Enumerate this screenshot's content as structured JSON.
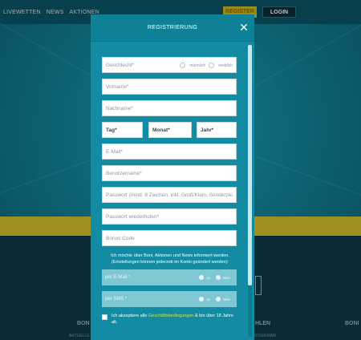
{
  "background": {
    "nav": [
      "LIVEWETTEN",
      "NEWS",
      "AKTIONEN"
    ],
    "register_label": "REGISTER",
    "login_label": "LOGIN",
    "footer_left": "BON",
    "footer_mid": "HLEN",
    "footer_right": "BONI",
    "small_left": "AKTUELLE BONUSANGEBOTE UNTER",
    "small_mid": "VERIFIZIERUNG DAS PROGRAMM"
  },
  "modal": {
    "title": "REGISTRIERUNG",
    "close_icon": "close-icon",
    "fields": {
      "gender_placeholder": "Geschlecht*",
      "gender_option_male": "männlich",
      "gender_option_female": "weiblich",
      "firstname_placeholder": "Vorname*",
      "lastname_placeholder": "Nachname*",
      "day_placeholder": "Tag*",
      "month_placeholder": "Monat*",
      "year_placeholder": "Jahr*",
      "email_placeholder": "E-Mail*",
      "username_placeholder": "Benutzername*",
      "password_placeholder": "Passwort (mind. 8 Zeichen, inkl. Groß/Klein, Sonderzei...",
      "password_repeat_placeholder": "Passwort wiederholen*",
      "bonus_code_placeholder": "Bonus Code"
    },
    "info_text": "Ich möchte über Boni, Aktionen und News informiert werden. (Einstellungen können jederzeit im Konto geändert werden):",
    "options": [
      {
        "label": "per E-Mail *",
        "yes": "Ja",
        "no": "Nein"
      },
      {
        "label": "per SMS *",
        "yes": "Ja",
        "no": "Nein"
      }
    ],
    "accept": {
      "prefix": "Ich akzeptiere alle ",
      "link": "Geschäftsbedingungen",
      "suffix": " & bin über 18 Jahre alt."
    }
  },
  "colors": {
    "modal_bg": "#138ba2",
    "accent_yellow": "#d3b91e",
    "link_color": "#d3e34a"
  }
}
